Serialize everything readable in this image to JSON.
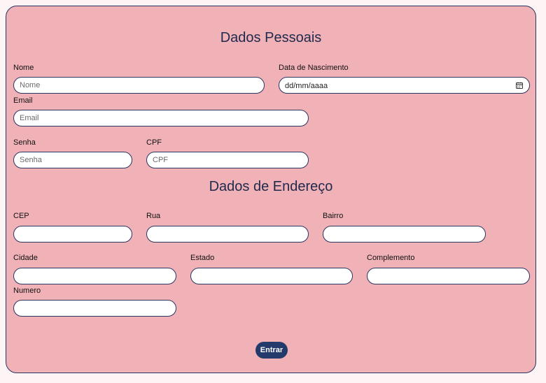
{
  "personal": {
    "heading": "Dados Pessoais",
    "nome_label": "Nome",
    "nome_placeholder": "Nome",
    "nascimento_label": "Data de Nascimento",
    "nascimento_value": "dd/mm/aaaa",
    "email_label": "Email",
    "email_placeholder": "Email",
    "senha_label": "Senha",
    "senha_placeholder": "Senha",
    "cpf_label": "CPF",
    "cpf_placeholder": "CPF"
  },
  "address": {
    "heading": "Dados de Endereço",
    "cep_label": "CEP",
    "rua_label": "Rua",
    "bairro_label": "Bairro",
    "cidade_label": "Cidade",
    "estado_label": "Estado",
    "complemento_label": "Complemento",
    "numero_label": "Numero"
  },
  "submit_label": "Entrar",
  "icons": {
    "date_picker": "calendar-icon"
  },
  "colors": {
    "card_bg": "#f0b1b7",
    "accent": "#233a6b",
    "border": "#2a3560"
  }
}
